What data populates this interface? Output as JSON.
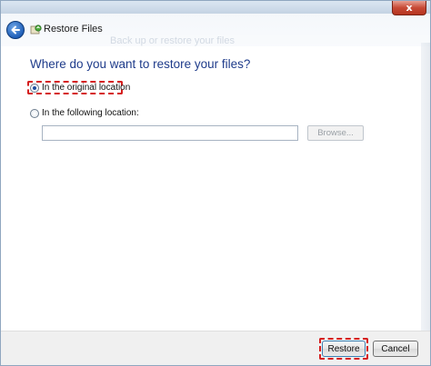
{
  "window": {
    "title": "Restore Files",
    "close_label": "x",
    "faded_heading": "Back up or restore your files"
  },
  "main": {
    "heading": "Where do you want to restore your files?",
    "options": [
      {
        "label": "In the original location",
        "selected": true
      },
      {
        "label": "In the following location:",
        "selected": false
      }
    ],
    "path_input": {
      "value": "",
      "placeholder": ""
    },
    "browse_label": "Browse..."
  },
  "footer": {
    "restore_label": "Restore",
    "cancel_label": "Cancel"
  },
  "colors": {
    "heading": "#1e3b8a",
    "highlight": "#d51f1f"
  },
  "icons": {
    "back": "back-arrow-icon",
    "app": "restore-files-icon"
  }
}
